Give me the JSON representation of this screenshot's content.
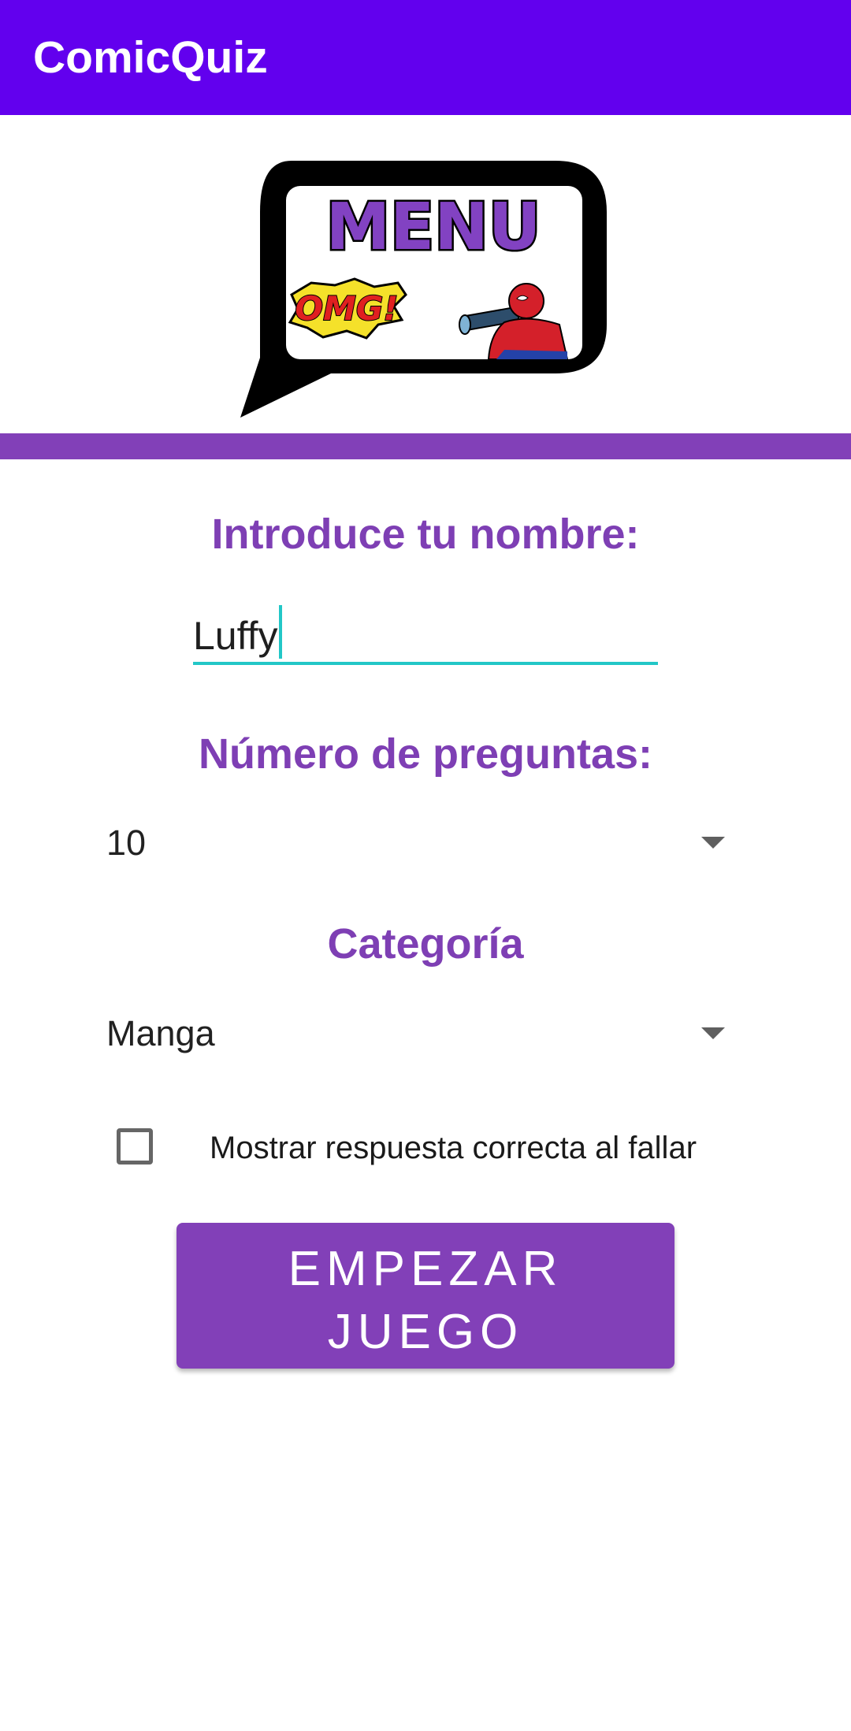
{
  "app_bar": {
    "title": "ComicQuiz",
    "color": "#6200EE"
  },
  "banner": {
    "icon": "menu-speech-bubble-image",
    "title": "MENU",
    "burst_text": "OMG!",
    "character": "spider-man-with-telescope"
  },
  "divider_color": "#8240B8",
  "name_section": {
    "heading": "Introduce tu nombre:",
    "value": "Luffy"
  },
  "questions_section": {
    "heading": "Número de preguntas:",
    "selected": "10"
  },
  "category_section": {
    "heading": "Categoría",
    "selected": "Manga"
  },
  "show_answer": {
    "label": "Mostrar respuesta correcta al fallar",
    "checked": false
  },
  "start_button": {
    "line1": "EMPEZAR",
    "line2": "JUEGO"
  },
  "colors": {
    "accent": "#7E3FB4",
    "field_underline": "#22C7C7"
  }
}
